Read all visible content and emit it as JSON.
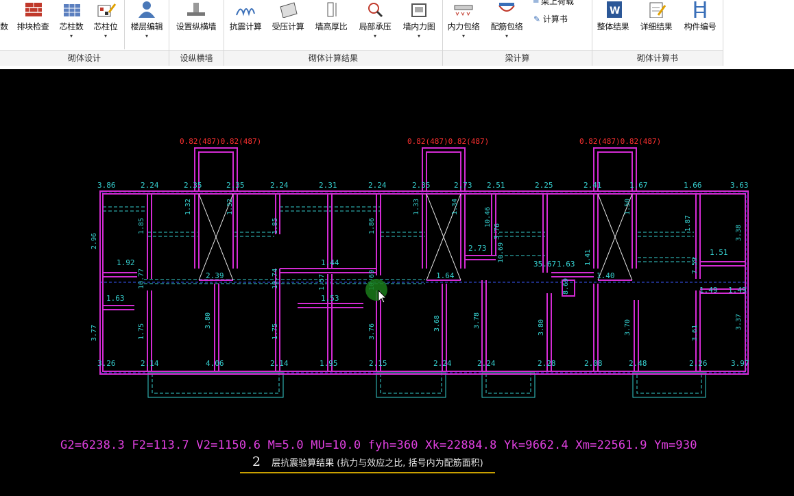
{
  "ribbon": {
    "groups": [
      {
        "label": "砌体设计",
        "buttons": [
          "数",
          "排块检查",
          "芯柱数",
          "芯柱位",
          "楼层编辑"
        ]
      },
      {
        "label": "设纵横墙",
        "buttons": [
          "设置纵横墙"
        ]
      },
      {
        "label": "砌体计算结果",
        "buttons": [
          "抗震计算",
          "受压计算",
          "墙高厚比",
          "局部承压",
          "墙内力图"
        ]
      },
      {
        "label": "梁计算",
        "buttons": [
          "内力包络",
          "配筋包络"
        ],
        "small": [
          "梁上荷载",
          "计算书"
        ]
      },
      {
        "label": "砌体计算书",
        "buttons": [
          "整体结果",
          "详细结果",
          "构件编号"
        ]
      }
    ]
  },
  "plan": {
    "top_red_labels": [
      "0.82(487)0.82(487)",
      "0.82(487)0.82(487)",
      "0.82(487)0.82(487)"
    ],
    "top_dims": [
      "3.86",
      "2.24",
      "2.35",
      "2.35",
      "2.24",
      "2.31",
      "2.24",
      "2.35",
      "2.73",
      "2.51",
      "2.25",
      "2.41",
      "1.67",
      "1.66",
      "3.63"
    ],
    "bottom_dims": [
      "3.26",
      "2.14",
      "4.06",
      "2.14",
      "1.95",
      "2.15",
      "2.24",
      "2.24",
      "2.28",
      "2.08",
      "2.48",
      "2.26",
      "3.97"
    ],
    "mid_dims": [
      "1.92",
      "1.63",
      "2.39",
      "1.44",
      "1.53",
      "1.64",
      "2.73",
      "35.67",
      "1.63",
      "1.40",
      "1.51",
      "1.49",
      "1.49"
    ],
    "vert_dims": [
      "2.96",
      "1.85",
      "10.77",
      "3.77",
      "1.75",
      "1.32",
      "1.32",
      "3.80",
      "1.85",
      "10.74",
      "1.75",
      "1.57",
      "1.86",
      "10.69",
      "3.76",
      "1.33",
      "1.34",
      "3.68",
      "10.46",
      "3.76",
      "10.69",
      "3.78",
      "3.80",
      "8.69",
      "1.41",
      "1.50",
      "3.70",
      "1.87",
      "7.59",
      "3.61",
      "3.38",
      "3.37"
    ]
  },
  "status_line": "G2=6238.3 F2=113.7 V2=1150.6 M=5.0 MU=10.0 fyh=360   Xk=22884.8 Yk=9662.4 Xm=22561.9 Ym=930",
  "caption": {
    "floor": "2",
    "text": "层抗震验算结果 (抗力与效应之比, 括号内为配筋面积)"
  },
  "colors": {
    "wall": "#d42bd4",
    "dim": "#36d1d1",
    "red": "#ff3030",
    "beam": "#3a58ff"
  }
}
